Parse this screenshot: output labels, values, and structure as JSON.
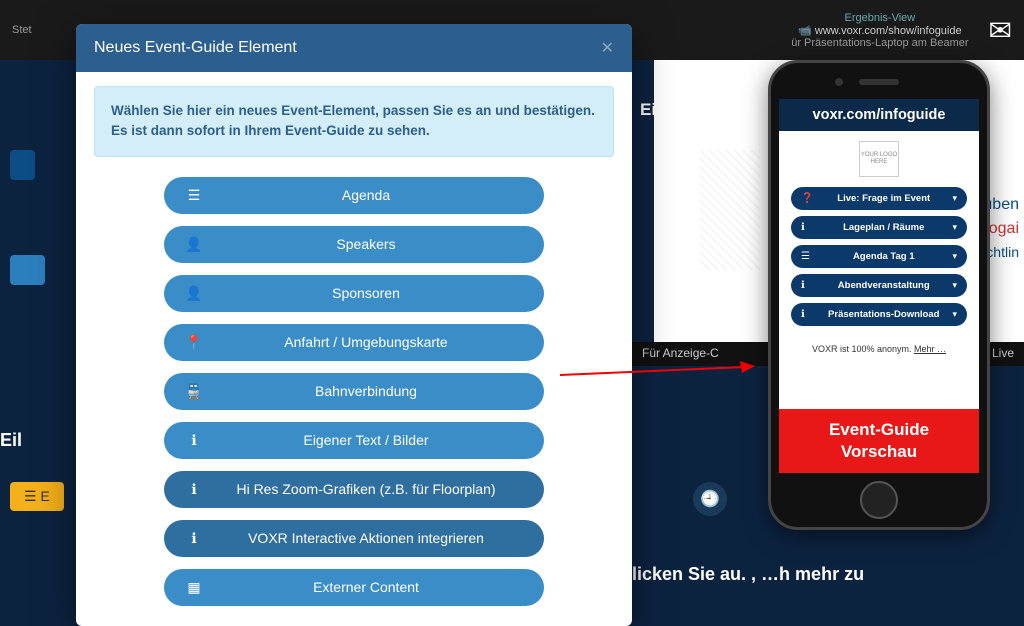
{
  "bg": {
    "top_left": "Stet",
    "ergebnis": "Ergebnis-View",
    "url_note": "www.voxr.com/show/infoguide",
    "laptop_note": "ür Präsentations-Laptop am Beamer",
    "right_word1": "Glauben",
    "right_word2": "Erdogai",
    "right_word3": "lüchtlin",
    "strip": "Für Anzeige-C",
    "strip_r": ". -- Live",
    "bottom": "licken Sie au.                               , …h mehr zu",
    "side": "Eil",
    "side2": "E",
    "heading_right": "Ei                                                     uell nic"
  },
  "modal": {
    "title": "Neues Event-Guide Element",
    "info": "Wählen Sie hier ein neues Event-Element, passen Sie es an und bestätigen. Es ist dann sofort in Ihrem Event-Guide zu sehen.",
    "options": {
      "agenda": "Agenda",
      "speakers": "Speakers",
      "sponsoren": "Sponsoren",
      "anfahrt": "Anfahrt / Umgebungskarte",
      "bahn": "Bahnverbindung",
      "text": "Eigener Text / Bilder",
      "hires": "Hi Res Zoom-Grafiken (z.B. für Floorplan)",
      "voxr": "VOXR Interactive Aktionen integrieren",
      "extern": "Externer Content"
    }
  },
  "phone": {
    "url": "voxr.com/infoguide",
    "logo": "YOUR LOGO HERE",
    "items": {
      "live": "Live: Frage im Event",
      "lageplan": "Lageplan / Räume",
      "agenda": "Agenda Tag 1",
      "abend": "Abendveranstaltung",
      "download": "Präsentations-Download"
    },
    "footer_a": "VOXR ist 100% anonym. ",
    "footer_b": "Mehr …",
    "red_a": "Event-Guide",
    "red_b": "Vorschau"
  }
}
